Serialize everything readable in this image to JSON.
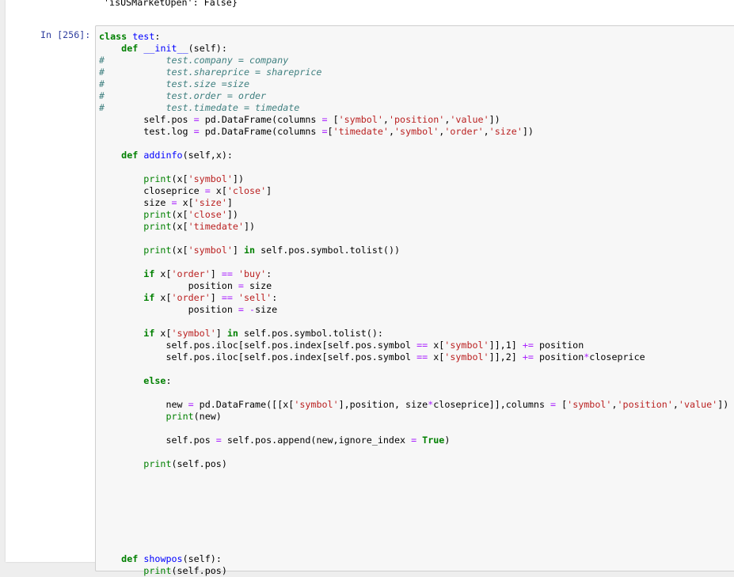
{
  "previous_output": {
    "text": "'isUSMarketOpen': False}"
  },
  "cell": {
    "prompt": "In [256]:",
    "language": "python",
    "colors": {
      "keyword": "#008000",
      "string": "#ba2121",
      "comment": "#408080",
      "operator": "#aa22ff",
      "function_name": "#0000ff",
      "prompt": "#303f9f",
      "cell_background": "#f7f7f7",
      "cell_border": "#cfcfcf"
    },
    "lines": [
      "class test:",
      "    def __init__(self):",
      "#           test.company = company",
      "#           test.shareprice = shareprice",
      "#           test.size =size",
      "#           test.order = order",
      "#           test.timedate = timedate",
      "        self.pos = pd.DataFrame(columns = ['symbol','position','value'])",
      "        test.log = pd.DataFrame(columns =['timedate','symbol','order','size'])",
      "",
      "    def addinfo(self,x):",
      "",
      "        print(x['symbol'])",
      "        closeprice = x['close']",
      "        size = x['size']",
      "        print(x['close'])",
      "        print(x['timedate'])",
      "",
      "        print(x['symbol'] in self.pos.symbol.tolist())",
      "",
      "        if x['order'] == 'buy':",
      "                position = size",
      "        if x['order'] == 'sell':",
      "                position = -size",
      "",
      "        if x['symbol'] in self.pos.symbol.tolist():",
      "            self.pos.iloc[self.pos.index[self.pos.symbol == x['symbol']],1] += position",
      "            self.pos.iloc[self.pos.index[self.pos.symbol == x['symbol']],2] += position*closeprice",
      "",
      "        else:",
      "",
      "            new = pd.DataFrame([[x['symbol'],position, size*closeprice]],columns = ['symbol','position','value'])",
      "            print(new)",
      "",
      "            self.pos = self.pos.append(new,ignore_index = True)",
      "",
      "        print(self.pos)",
      "",
      "",
      "",
      "",
      "",
      "",
      "",
      "    def showpos(self):",
      "        print(self.pos)"
    ]
  }
}
